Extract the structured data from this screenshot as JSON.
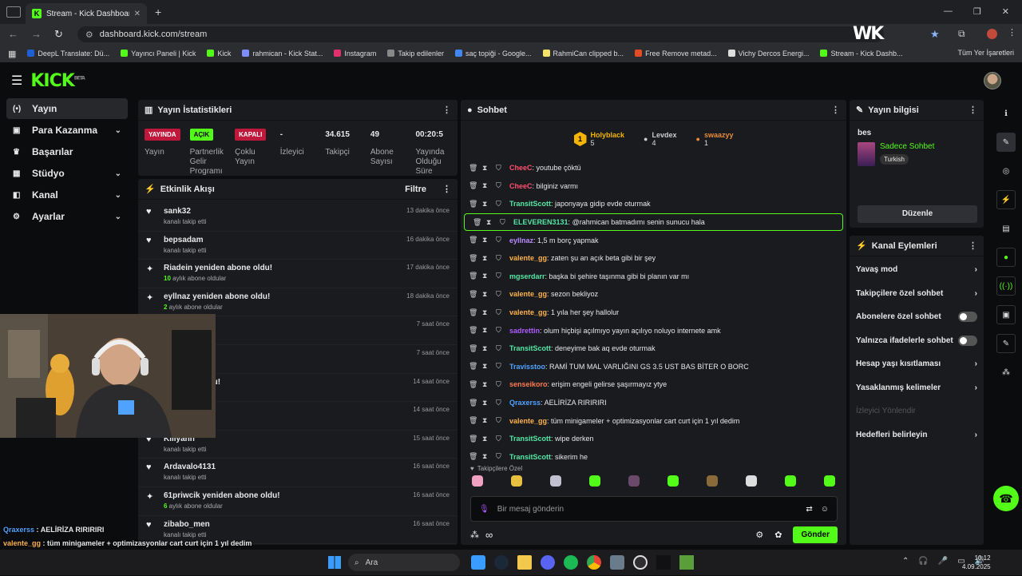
{
  "browser": {
    "tab_title": "Stream - Kick Dashboard",
    "tab_close": "✕",
    "new_tab": "+",
    "url": "dashboard.kick.com/stream",
    "overlay_logo": "WK",
    "bookmarks": [
      {
        "label": "DeepL Translate: Dü...",
        "color": "#1e5fd6"
      },
      {
        "label": "Yayıncı Paneli | Kick",
        "color": "#53fc18"
      },
      {
        "label": "Kick",
        "color": "#53fc18"
      },
      {
        "label": "rahmican - Kick Stat...",
        "color": "#7d8cff"
      },
      {
        "label": "Instagram",
        "color": "#e1306c"
      },
      {
        "label": "Takip edilenler",
        "color": "#888888"
      },
      {
        "label": "saç topiği - Google...",
        "color": "#4285f4"
      },
      {
        "label": "RahmiCan clipped b...",
        "color": "#f5e26a"
      },
      {
        "label": "Free Remove metad...",
        "color": "#e34c26"
      },
      {
        "label": "Vichy Dercos Energi...",
        "color": "#dddddd"
      },
      {
        "label": "Stream - Kick Dashb...",
        "color": "#53fc18"
      }
    ],
    "all_bookmarks": "Tüm Yer İşaretleri"
  },
  "app": {
    "logo": "KICK",
    "beta": "BETA"
  },
  "sidebar": {
    "items": [
      {
        "label": "Yayın",
        "icon": "(•)",
        "chev": ""
      },
      {
        "label": "Para Kazanma",
        "icon": "▣",
        "chev": "⌄"
      },
      {
        "label": "Başarılar",
        "icon": "♛",
        "chev": ""
      },
      {
        "label": "Stüdyo",
        "icon": "▦",
        "chev": "⌄"
      },
      {
        "label": "Kanal",
        "icon": "◧",
        "chev": "⌄"
      },
      {
        "label": "Ayarlar",
        "icon": "⚙",
        "chev": "⌄"
      }
    ]
  },
  "stats": {
    "title": "Yayın İstatistikleri",
    "items": [
      {
        "value": "YAYINDA",
        "badge": "#c0183b",
        "label": "Yayın"
      },
      {
        "value": "AÇIK",
        "badge": "#53fc18",
        "label": "Partnerlik Gelir Programı"
      },
      {
        "value": "KAPALI",
        "badge": "#c0183b",
        "label": "Çoklu Yayın"
      },
      {
        "value": "-",
        "badge": "",
        "label": "İzleyici"
      },
      {
        "value": "34.615",
        "badge": "",
        "label": "Takipçi"
      },
      {
        "value": "49",
        "badge": "",
        "label": "Abone Sayısı"
      },
      {
        "value": "00:20:5",
        "badge": "",
        "label": "Yayında Olduğu Süre"
      }
    ]
  },
  "feed": {
    "title": "Etkinlik Akışı",
    "filter": "Filtre",
    "items": [
      {
        "icon": "♥",
        "name": "sank32",
        "sub": "kanalı takip etti",
        "count": "",
        "time": "13 dakika önce"
      },
      {
        "icon": "♥",
        "name": "bepsadam",
        "sub": "kanalı takip etti",
        "count": "",
        "time": "16 dakika önce"
      },
      {
        "icon": "✦",
        "name": "Riadein yeniden abone oldu!",
        "sub": " aylık abone oldular",
        "count": "10",
        "time": "17 dakika önce"
      },
      {
        "icon": "✦",
        "name": "eyllnaz yeniden abone oldu!",
        "sub": " aylık abone oldular",
        "count": "2",
        "time": "18 dakika önce"
      },
      {
        "icon": "♥",
        "name": "",
        "sub": "",
        "count": "",
        "time": "7 saat önce"
      },
      {
        "icon": "♥",
        "name": "",
        "sub": "",
        "count": "",
        "time": "7 saat önce"
      },
      {
        "icon": "✦",
        "name": "en abone oldu!",
        "sub": "ular",
        "count": "",
        "time": "14 saat önce"
      },
      {
        "icon": "♥",
        "name": "",
        "sub": "",
        "count": "",
        "time": "14 saat önce"
      },
      {
        "icon": "♥",
        "name": "Kiliyann",
        "sub": "kanalı takip etti",
        "count": "",
        "time": "15 saat önce"
      },
      {
        "icon": "♥",
        "name": "Ardavalo4131",
        "sub": "kanalı takip etti",
        "count": "",
        "time": "16 saat önce"
      },
      {
        "icon": "✦",
        "name": "61priwcik yeniden abone oldu!",
        "sub": " aylık abone oldular",
        "count": "6",
        "time": "16 saat önce"
      },
      {
        "icon": "♥",
        "name": "zibabo_men",
        "sub": "kanalı takip etti",
        "count": "",
        "time": "16 saat önce"
      }
    ]
  },
  "chat": {
    "title": "Sohbet",
    "leaders": [
      {
        "rank": "1",
        "name": "Holyblack",
        "count": "5",
        "color": "#f5b400"
      },
      {
        "rank": "",
        "name": "Levdex",
        "count": "4",
        "color": "#cccccc"
      },
      {
        "rank": "",
        "name": "swaazyy",
        "count": "1",
        "color": "#e88a3a"
      }
    ],
    "messages": [
      {
        "user": "CheeC",
        "color": "#ff4f6e",
        "text": "youtube çöktü"
      },
      {
        "user": "CheeC",
        "color": "#ff4f6e",
        "text": "bilginiz varmı"
      },
      {
        "user": "TransitScott",
        "color": "#53e8a6",
        "text": "japonyaya gidip evde oturmak"
      },
      {
        "user": "ELEVEREN3131",
        "color": "#53e8a6",
        "text": "@rahmican batmadımı senin sunucu hala"
      },
      {
        "user": "eyllnaz",
        "color": "#b98cff",
        "text": "1,5 m borç yapmak"
      },
      {
        "user": "valente_gg",
        "color": "#ffb347",
        "text": "zaten şu an açık beta gibi bir şey"
      },
      {
        "user": "mgserdarr",
        "color": "#53e8a6",
        "text": "başka bi şehire taşınma gibi bi planın var mı"
      },
      {
        "user": "valente_gg",
        "color": "#ffb347",
        "text": "sezon bekliyoz"
      },
      {
        "user": "valente_gg",
        "color": "#ffb347",
        "text": "1 yıla her şey hallolur"
      },
      {
        "user": "sadrettin",
        "color": "#b25cff",
        "text": "olum hiçbişi açılmıyo yayın açılıyo noluyo internete amk"
      },
      {
        "user": "TransitScott",
        "color": "#53e8a6",
        "text": "deneyime bak aq evde oturmak"
      },
      {
        "user": "Travisstoo",
        "color": "#4fa3ff",
        "text": "RAMİ TUM MAL VARLIĞINI GS 3.5 UST BAS BİTER O BORC"
      },
      {
        "user": "senseikoro",
        "color": "#ff7a4f",
        "text": "erişim engeli gelirse şaşırmayız ytye"
      },
      {
        "user": "Qraxerss",
        "color": "#4fa3ff",
        "text": "AELİRİZA RIRIRIRI"
      },
      {
        "user": "valente_gg",
        "color": "#ffb347",
        "text": "tüm minigameler + optimizasyonlar cart curt için 1 yıl dedim"
      },
      {
        "user": "TransitScott",
        "color": "#53e8a6",
        "text": "wipe derken"
      },
      {
        "user": "TransitScott",
        "color": "#53e8a6",
        "text": "sikerim he"
      }
    ],
    "followers_only": "Takipçilere Özel",
    "placeholder": "Bir mesaj gönderin",
    "send": "Gönder",
    "infinity": "∞"
  },
  "info": {
    "title": "Yayın bilgisi",
    "stream_title": "bes",
    "category": "Sadece Sohbet",
    "lang": "Turkish",
    "edit": "Düzenle"
  },
  "actions": {
    "title": "Kanal Eylemleri",
    "items": [
      {
        "label": "Yavaş mod",
        "type": "chev"
      },
      {
        "label": "Takipçilere özel sohbet",
        "type": "chev"
      },
      {
        "label": "Abonelere özel sohbet",
        "type": "toggle"
      },
      {
        "label": "Yalnızca ifadelerle sohbet",
        "type": "toggle"
      },
      {
        "label": "Hesap yaşı kısıtlaması",
        "type": "chev"
      },
      {
        "label": "Yasaklanmış kelimeler",
        "type": "chev"
      },
      {
        "label": "İzleyici Yönlendir",
        "type": "disabled"
      },
      {
        "label": "Hedefleri belirleyin",
        "type": "chev"
      }
    ]
  },
  "overlay": [
    {
      "user": "Qraxerss",
      "color": "#4fa3ff",
      "text": " : AELİRİZA RIRIRIRI"
    },
    {
      "user": "valente_gg",
      "color": "#ffb347",
      "text": " : tüm minigameler + optimizasyonlar cart curt için 1 yıl dedim"
    },
    {
      "user": "TransitScott",
      "color": "#53e8a6",
      "text": " : wipe derken"
    },
    {
      "user": "TransitScott",
      "color": "#53e8a6",
      "text": " : sikerim he"
    }
  ],
  "taskbar": {
    "search": "Ara",
    "time": "10:12",
    "date": "4.09.2025"
  }
}
